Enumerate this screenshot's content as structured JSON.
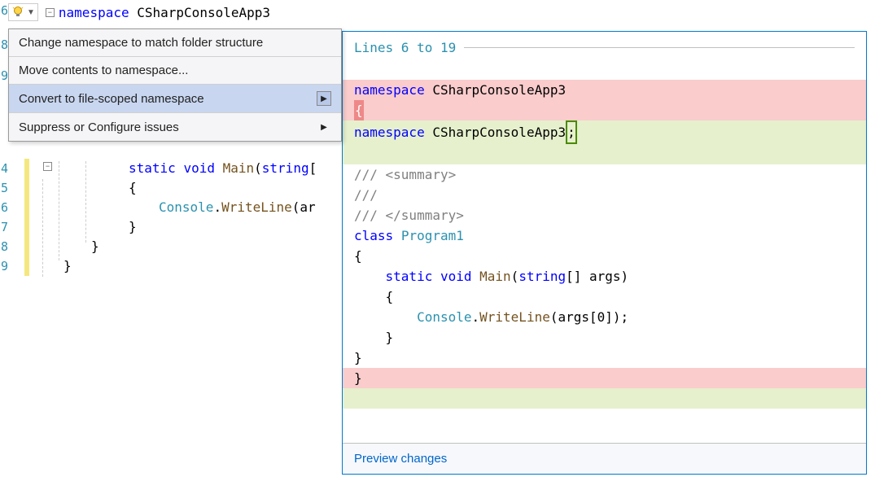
{
  "editor": {
    "bulb_tooltip": "Quick Actions",
    "top_line": {
      "keyword": "namespace",
      "name": "CSharpConsoleApp3"
    },
    "line_numbers": [
      "6",
      "8",
      "9",
      "4",
      "5",
      "6",
      "7",
      "8",
      "9"
    ],
    "code": {
      "l4_pre": "            ",
      "l4_kw1": "static",
      "l4_kw2": "void",
      "l4_method": "Main",
      "l4_paren": "(",
      "l4_kw3": "string",
      "l4_rest": "[",
      "l5": "            {",
      "l6_pre": "                ",
      "l6_type": "Console",
      "l6_dot": ".",
      "l6_method": "WriteLine",
      "l6_rest": "(ar",
      "l7": "            }",
      "l8": "        }",
      "l9": "    }"
    }
  },
  "menu": {
    "items": [
      {
        "label": "Change namespace to match folder structure",
        "submenu": false
      },
      {
        "label": "Move contents to namespace...",
        "submenu": false
      },
      {
        "label": "Convert to file-scoped namespace",
        "submenu": true,
        "selected": true
      },
      {
        "label": "Suppress or Configure issues",
        "submenu": true,
        "plain_arrow": true
      }
    ]
  },
  "preview": {
    "header": "Lines 6 to 19",
    "footer": "Preview changes",
    "lines": {
      "ns_kw": "namespace",
      "ns_name": "CSharpConsoleApp3",
      "brace_open": "{",
      "semicolon": ";",
      "doc1": "/// <summary>",
      "doc2": "///",
      "doc3": "/// </summary>",
      "class_kw": "class",
      "class_name": "Program1",
      "brace": "{",
      "main_kw1": "static",
      "main_kw2": "void",
      "main_name": "Main",
      "main_paren_open": "(",
      "main_kw3": "string",
      "main_rest": "[] args)",
      "brace2": "{",
      "console_type": "Console",
      "console_dot": ".",
      "writeline": "WriteLine",
      "writeline_rest": "(args[0]);",
      "brace_close": "}",
      "brace_close2": "}",
      "brace_close3": "}"
    }
  }
}
